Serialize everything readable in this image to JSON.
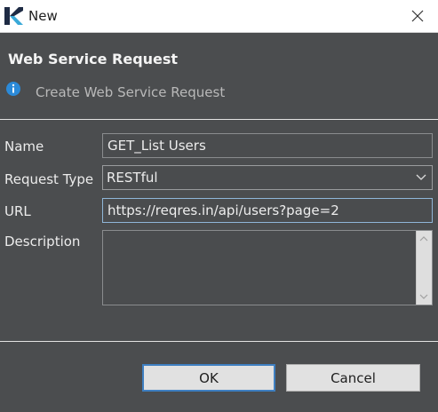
{
  "window": {
    "title": "New",
    "logo_icon": "katalon-logo-icon",
    "close_icon": "close-icon"
  },
  "header": {
    "title": "Web Service Request",
    "subtitle": "Create Web Service Request",
    "info_icon": "info-icon"
  },
  "form": {
    "name": {
      "label": "Name",
      "value": "GET_List Users"
    },
    "request_type": {
      "label": "Request Type",
      "value": "RESTful"
    },
    "url": {
      "label": "URL",
      "value": "https://reqres.in/api/users?page=2"
    },
    "description": {
      "label": "Description",
      "value": ""
    }
  },
  "buttons": {
    "ok": "OK",
    "cancel": "Cancel"
  },
  "colors": {
    "dialog_bg": "#4b4d4f",
    "info_blue": "#2b8ad8",
    "focus_border": "#3e7fc1"
  }
}
